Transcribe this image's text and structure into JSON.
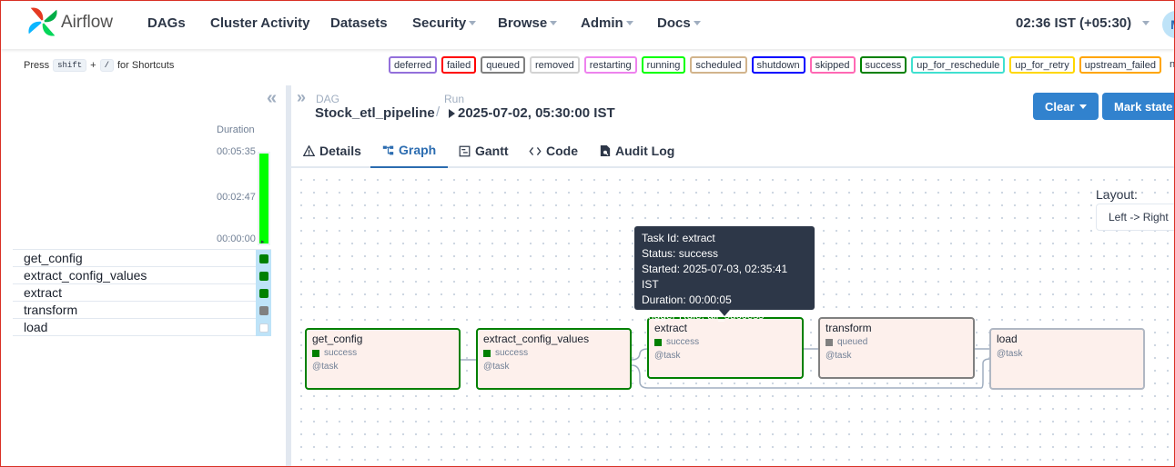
{
  "brand": "Airflow",
  "nav": [
    {
      "label": "DAGs",
      "dropdown": false
    },
    {
      "label": "Cluster Activity",
      "dropdown": false
    },
    {
      "label": "Datasets",
      "dropdown": false
    },
    {
      "label": "Security",
      "dropdown": true
    },
    {
      "label": "Browse",
      "dropdown": true
    },
    {
      "label": "Admin",
      "dropdown": true
    },
    {
      "label": "Docs",
      "dropdown": true
    }
  ],
  "clock": "02:36 IST (+05:30)",
  "avatar_initial": "M",
  "shortcuts": {
    "press": "Press",
    "key1": "shift",
    "plus": "+",
    "key2": "/",
    "suffix": "for Shortcuts"
  },
  "legend": [
    {
      "label": "deferred",
      "color": "#9370db"
    },
    {
      "label": "failed",
      "color": "#ff0000"
    },
    {
      "label": "queued",
      "color": "#808080"
    },
    {
      "label": "removed",
      "color": "#d3d3d3"
    },
    {
      "label": "restarting",
      "color": "#ee82ee"
    },
    {
      "label": "running",
      "color": "#00ff00"
    },
    {
      "label": "scheduled",
      "color": "#d2b48c"
    },
    {
      "label": "shutdown",
      "color": "#0000ff"
    },
    {
      "label": "skipped",
      "color": "#ff69b4"
    },
    {
      "label": "success",
      "color": "#008000"
    },
    {
      "label": "up_for_reschedule",
      "color": "#40e0d0"
    },
    {
      "label": "up_for_retry",
      "color": "#ffd700"
    },
    {
      "label": "upstream_failed",
      "color": "#ffa500"
    }
  ],
  "legend_tail": "no_",
  "duration": {
    "title": "Duration",
    "ticks": [
      "00:05:35",
      "00:02:47",
      "00:00:00"
    ],
    "bar_fraction": 1.0
  },
  "tasks": [
    {
      "name": "get_config",
      "state_color": "#008000"
    },
    {
      "name": "extract_config_values",
      "state_color": "#008000"
    },
    {
      "name": "extract",
      "state_color": "#008000"
    },
    {
      "name": "transform",
      "state_color": "#808080"
    },
    {
      "name": "load",
      "state_color": "#ffffff"
    }
  ],
  "breadcrumb": {
    "dag_label": "DAG",
    "dag_name": "Stock_etl_pipeline",
    "sep": "/",
    "run_label": "Run",
    "run_name": "2025-07-02, 05:30:00 IST"
  },
  "actions": {
    "clear": "Clear",
    "mark_state": "Mark state a"
  },
  "tabs": [
    {
      "label": "Details",
      "icon": "warning-icon"
    },
    {
      "label": "Graph",
      "icon": "graph-icon"
    },
    {
      "label": "Gantt",
      "icon": "gantt-icon"
    },
    {
      "label": "Code",
      "icon": "code-icon"
    },
    {
      "label": "Audit Log",
      "icon": "audit-log-icon"
    }
  ],
  "active_tab": "Graph",
  "layout": {
    "label": "Layout:",
    "value": "Left -> Right"
  },
  "graph_nodes": [
    {
      "title": "get_config",
      "status": "success",
      "status_color": "#008000",
      "border": "#008000",
      "op": "@task"
    },
    {
      "title": "extract_config_values",
      "status": "success",
      "status_color": "#008000",
      "border": "#008000",
      "op": "@task"
    },
    {
      "title": "extract",
      "status": "success",
      "status_color": "#008000",
      "border": "#008000",
      "op": "@task"
    },
    {
      "title": "transform",
      "status": "queued",
      "status_color": "#808080",
      "border": "#808080",
      "op": "@task"
    },
    {
      "title": "load",
      "status": "",
      "status_color": "",
      "border": "#b0b7c3",
      "op": "@task"
    }
  ],
  "tooltip": {
    "task_id": "Task Id: extract",
    "status": "Status: success",
    "started": "Started: 2025-07-03, 02:35:41 IST",
    "duration": "Duration: 00:00:05",
    "trigger_rule": "Trigger Rule: all_success"
  }
}
